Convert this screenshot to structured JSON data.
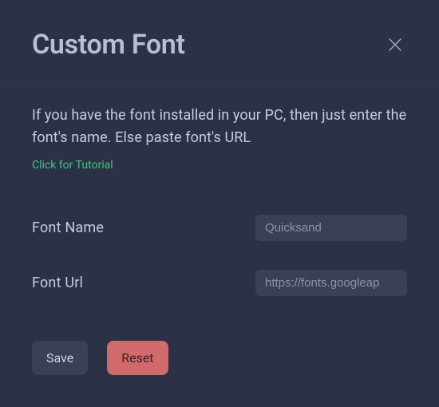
{
  "dialog": {
    "title": "Custom Font",
    "description": "If you have the font installed in your PC, then just enter the font's name. Else paste font's URL",
    "tutorial_link": "Click for Tutorial"
  },
  "form": {
    "font_name": {
      "label": "Font Name",
      "placeholder": "Quicksand",
      "value": ""
    },
    "font_url": {
      "label": "Font Url",
      "placeholder": "https://fonts.googleap",
      "value": ""
    }
  },
  "actions": {
    "save": "Save",
    "reset": "Reset"
  }
}
